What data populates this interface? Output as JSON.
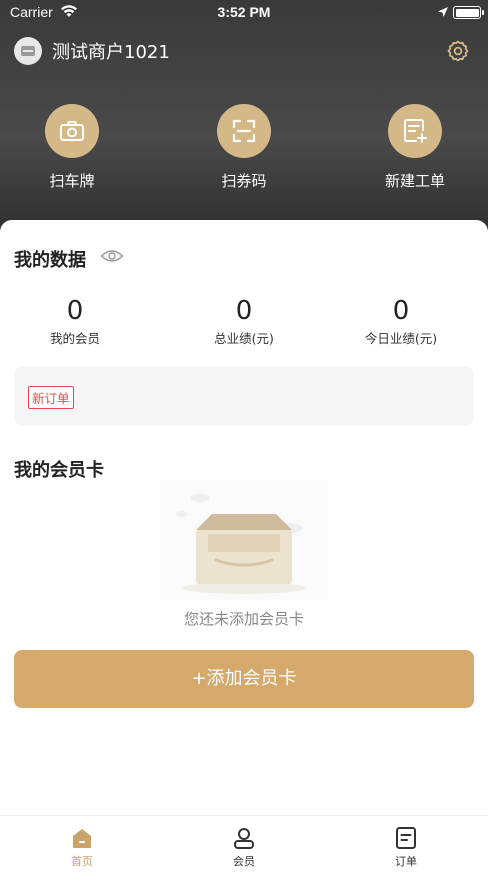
{
  "status_bar": {
    "carrier": "Carrier",
    "time": "3:52 PM"
  },
  "header": {
    "merchant_name": "测试商户1021"
  },
  "actions": [
    {
      "label": "扫车牌",
      "icon": "camera-icon"
    },
    {
      "label": "扫券码",
      "icon": "scan-icon"
    },
    {
      "label": "新建工单",
      "icon": "new-order-icon"
    }
  ],
  "my_data": {
    "title": "我的数据",
    "stats": [
      {
        "value": "0",
        "label": "我的会员"
      },
      {
        "value": "0",
        "label": "总业绩(元)"
      },
      {
        "value": "0",
        "label": "今日业绩(元)"
      }
    ],
    "order_badge": "新订单"
  },
  "member_card": {
    "title": "我的会员卡",
    "empty_text": "您还未添加会员卡",
    "add_button": "+添加会员卡"
  },
  "tabs": [
    {
      "label": "首页",
      "active": true
    },
    {
      "label": "会员",
      "active": false
    },
    {
      "label": "订单",
      "active": false
    }
  ],
  "colors": {
    "accent": "#d4a96b",
    "accent_light": "#d4b888",
    "badge_red": "#e24b4b"
  }
}
